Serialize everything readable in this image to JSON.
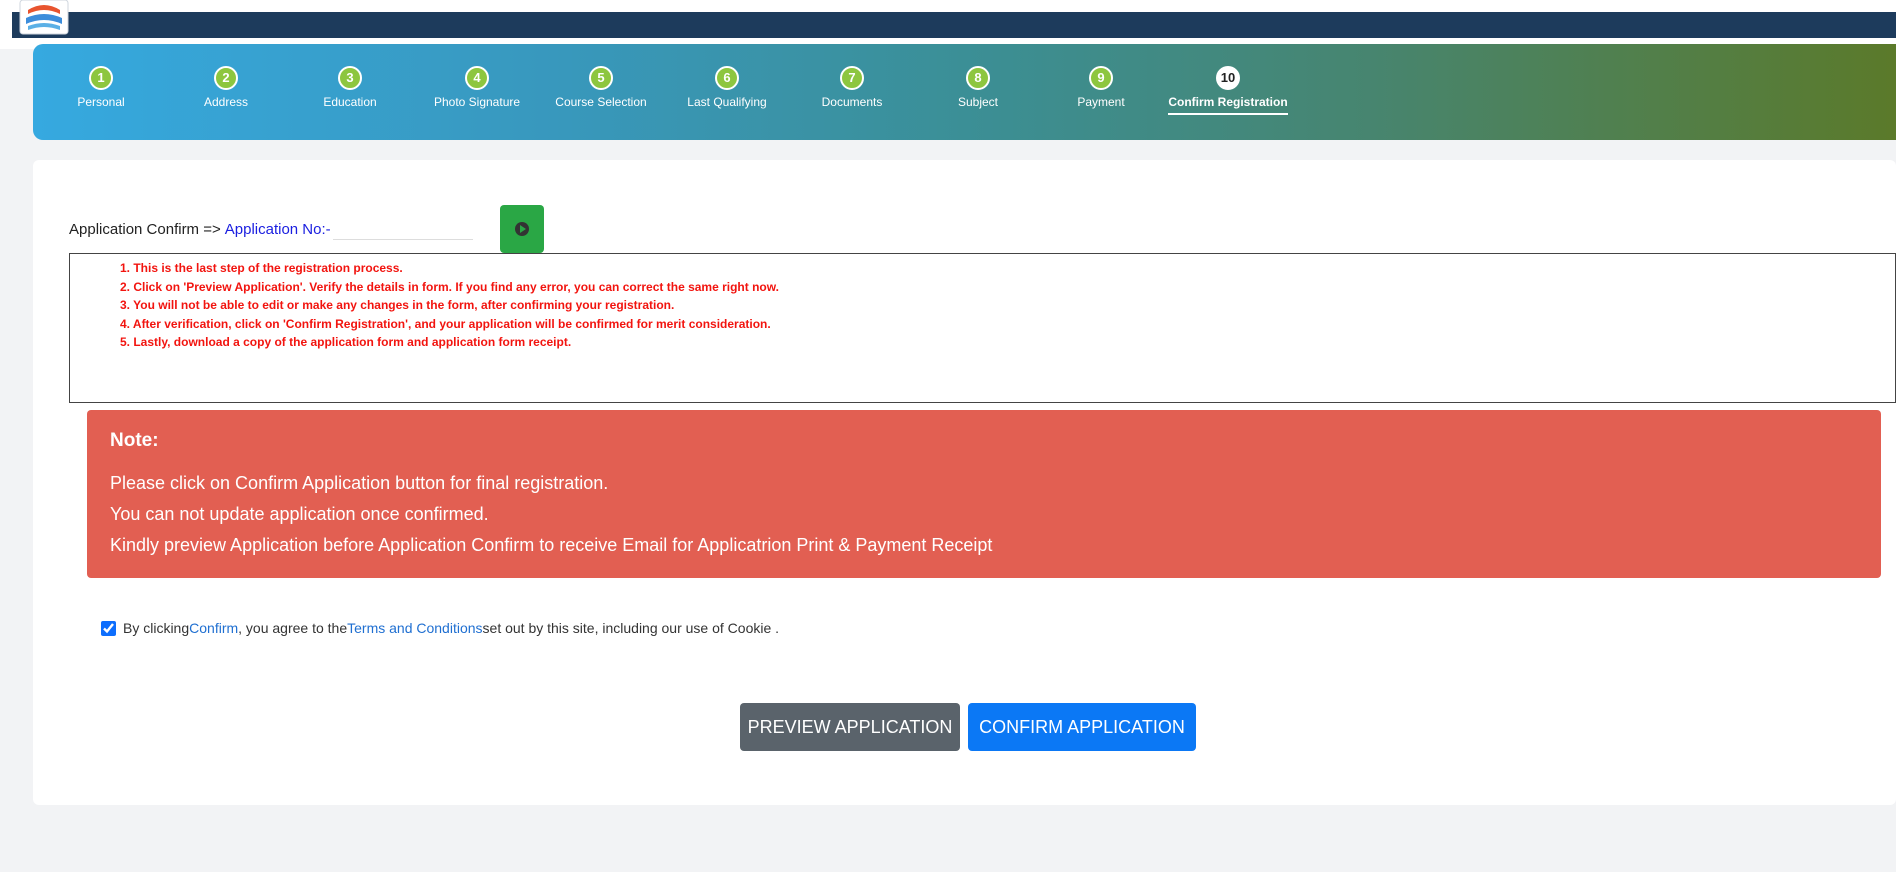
{
  "steps": [
    {
      "num": "1",
      "label": "Personal"
    },
    {
      "num": "2",
      "label": "Address"
    },
    {
      "num": "3",
      "label": "Education"
    },
    {
      "num": "4",
      "label": "Photo Signature"
    },
    {
      "num": "5",
      "label": "Course Selection"
    },
    {
      "num": "6",
      "label": "Last Qualifying"
    },
    {
      "num": "7",
      "label": "Documents"
    },
    {
      "num": "8",
      "label": "Subject"
    },
    {
      "num": "9",
      "label": "Payment"
    },
    {
      "num": "10",
      "label": "Confirm Registration"
    }
  ],
  "active_step": "10",
  "confirm": {
    "prefix": "Application Confirm =>",
    "app_no_label": "Application No:-"
  },
  "instructions": [
    "1. This is the last step of the registration process.",
    "2. Click on 'Preview Application'. Verify the details in form. If you find any error, you can correct the same right now.",
    "3. You will not be able to edit or make any changes in the form, after confirming your registration.",
    "4. After verification, click on 'Confirm Registration', and your application will be confirmed for merit consideration.",
    "5. Lastly, download a copy of the application form and application form receipt."
  ],
  "note": {
    "title": "Note:",
    "lines": [
      "Please click on Confirm Application button for final registration.",
      "You can not update application once confirmed.",
      "Kindly preview Application before Application Confirm to receive Email for Applicatrion Print & Payment Receipt"
    ]
  },
  "agreement": {
    "checked": true,
    "text1": "By clicking ",
    "link1": "Confirm",
    "text2": ", you agree to the ",
    "link2": "Terms and Conditions",
    "text3": " set out by this site, including our use of Cookie ."
  },
  "buttons": {
    "preview": "PREVIEW APPLICATION",
    "confirm": "CONFIRM APPLICATION"
  },
  "colors": {
    "step_done": "#8dc63f",
    "note_bg": "#e25f52",
    "instruction_text": "#f2140f",
    "confirm_button": "#0b78f5",
    "preview_button": "#5a636b",
    "go_button": "#2aa745"
  }
}
